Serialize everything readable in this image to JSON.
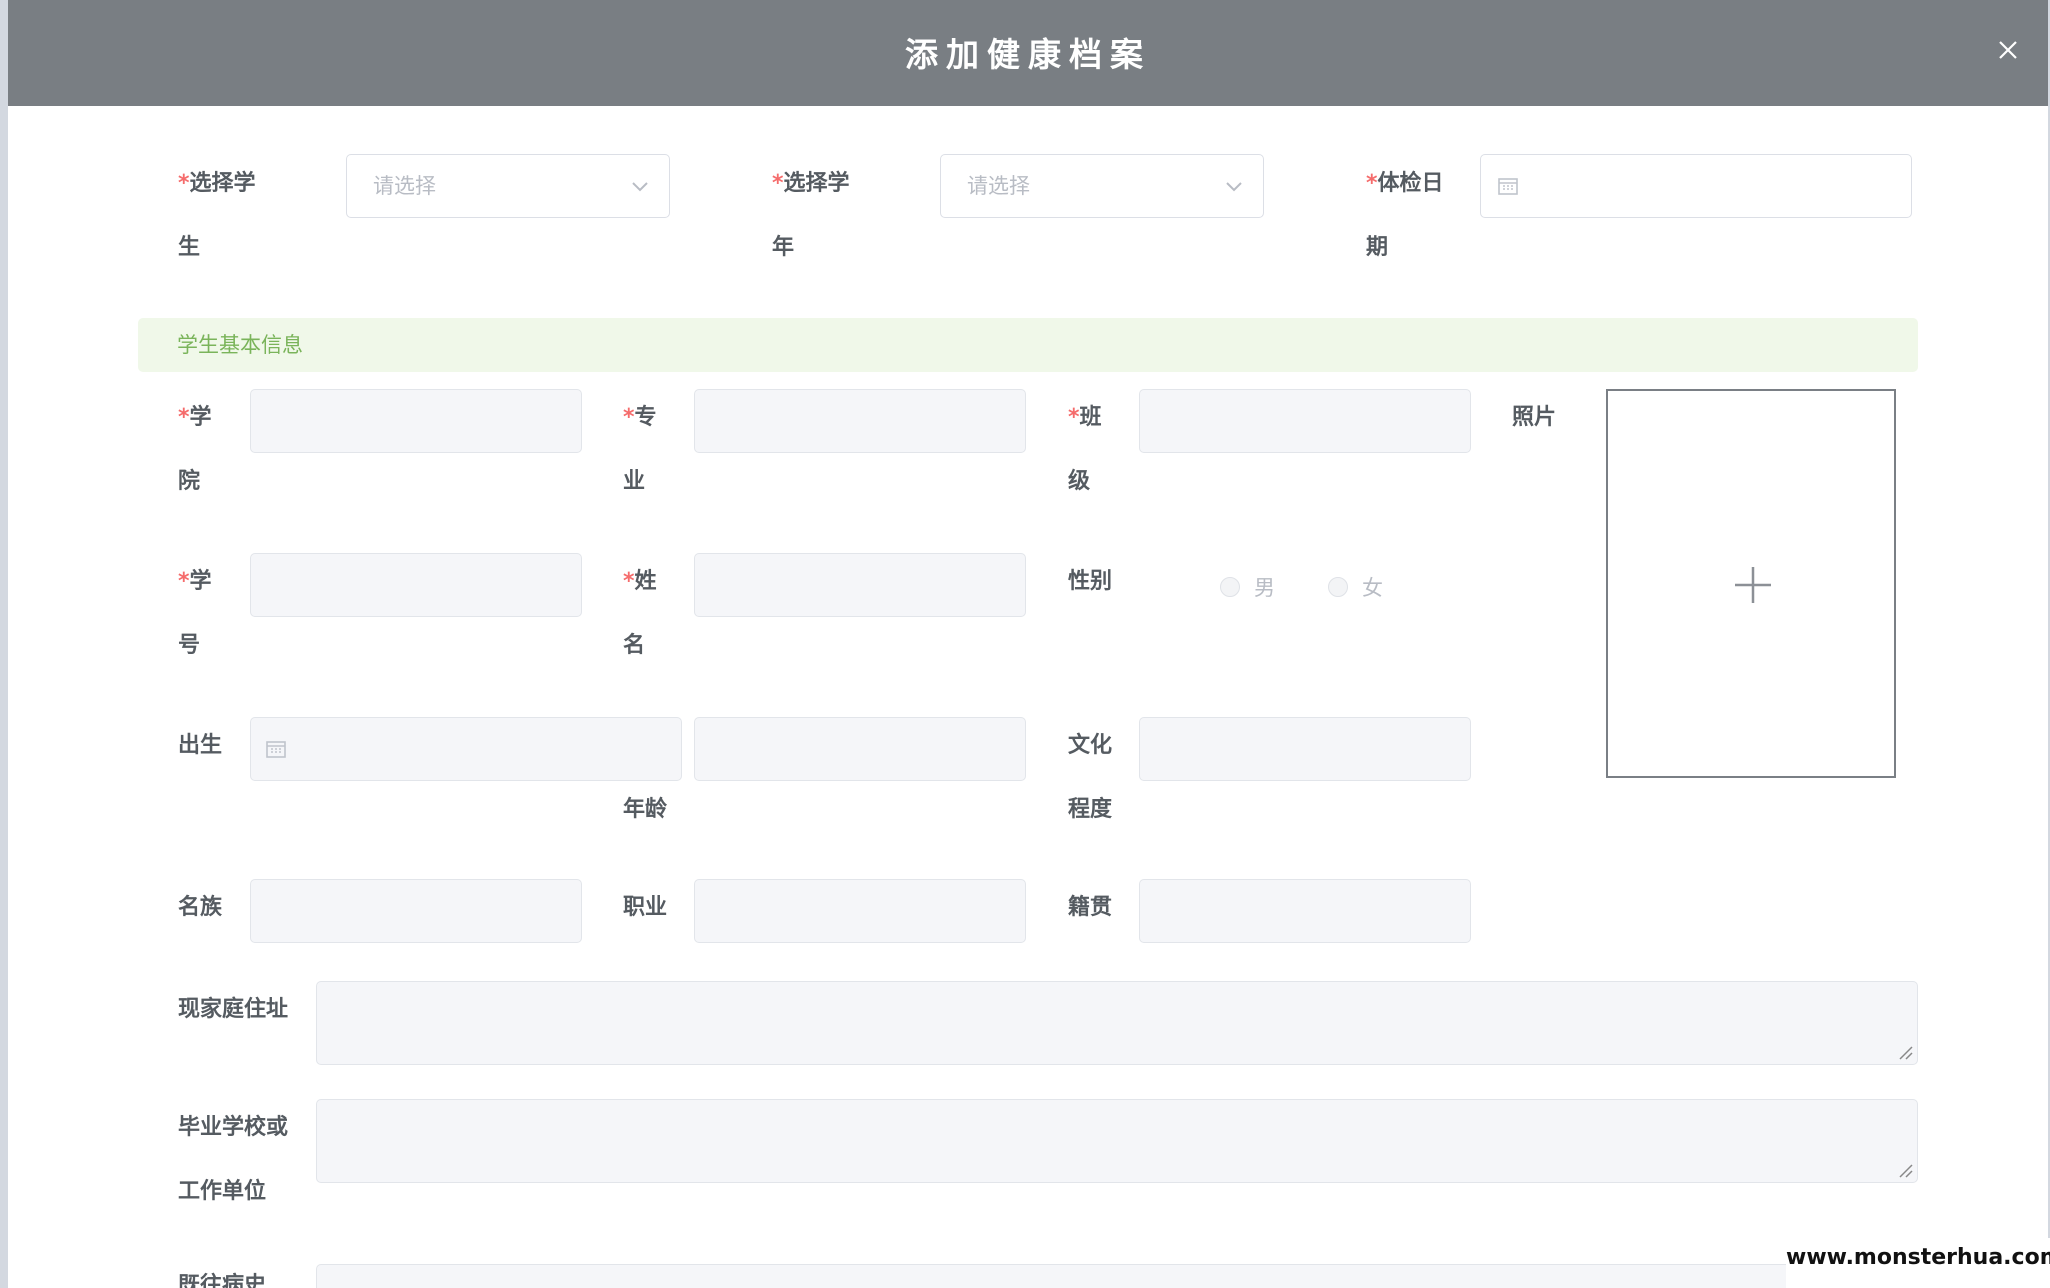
{
  "dialog": {
    "title": "添加健康档案",
    "close_icon": "close-icon"
  },
  "top_fields": {
    "student_label": "选择学\n生",
    "student_placeholder": "请选择",
    "year_label": "选择学\n年",
    "year_placeholder": "请选择",
    "date_label": "体检日\n期"
  },
  "required_mark": "*",
  "section": {
    "title": "学生基本信息"
  },
  "basic": {
    "college_label": "学\n院",
    "major_label": "专\n业",
    "class_label": "班\n级",
    "photo_label": "照片",
    "student_no_label": "学\n号",
    "name_label": "姓\n名",
    "gender_label": "性别",
    "gender_options": [
      "男",
      "女"
    ],
    "birth_label": "出生",
    "age_label": "年龄",
    "education_label": "文化\n程度",
    "ethnicity_label": "名族",
    "occupation_label": "职业",
    "native_place_label": "籍贯"
  },
  "address": {
    "home_label": "现家庭住址",
    "school_label": "毕业学校或\n工作单位",
    "history_label": "既往病史"
  },
  "watermark": "www.monsterhua.com",
  "colors": {
    "header": "#797e83",
    "required": "#f56c6c",
    "section_bg": "#f0f8e9",
    "section_text": "#7ab45a"
  }
}
